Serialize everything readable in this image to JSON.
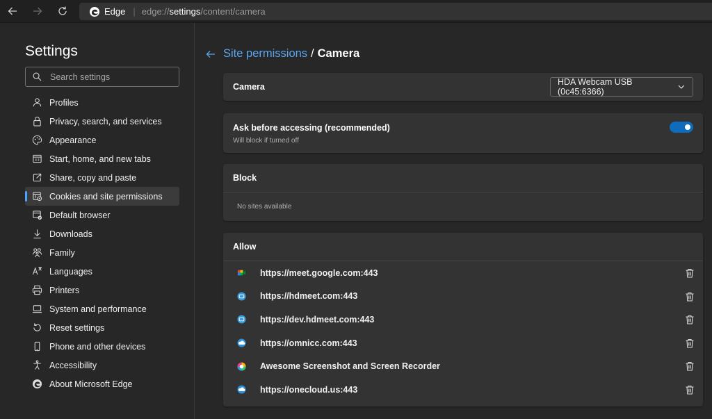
{
  "browser": {
    "site_name": "Edge",
    "url_prefix": "edge://",
    "url_host": "settings",
    "url_path": "/content/camera"
  },
  "sidebar": {
    "title": "Settings",
    "search_placeholder": "Search settings",
    "items": [
      {
        "label": "Profiles",
        "icon": "profile-icon"
      },
      {
        "label": "Privacy, search, and services",
        "icon": "lock-icon"
      },
      {
        "label": "Appearance",
        "icon": "appearance-icon"
      },
      {
        "label": "Start, home, and new tabs",
        "icon": "start-tabs-icon"
      },
      {
        "label": "Share, copy and paste",
        "icon": "share-icon"
      },
      {
        "label": "Cookies and site permissions",
        "icon": "cookies-icon",
        "active": true
      },
      {
        "label": "Default browser",
        "icon": "default-browser-icon"
      },
      {
        "label": "Downloads",
        "icon": "download-icon"
      },
      {
        "label": "Family",
        "icon": "family-icon"
      },
      {
        "label": "Languages",
        "icon": "languages-icon"
      },
      {
        "label": "Printers",
        "icon": "printer-icon"
      },
      {
        "label": "System and performance",
        "icon": "laptop-icon"
      },
      {
        "label": "Reset settings",
        "icon": "reset-icon"
      },
      {
        "label": "Phone and other devices",
        "icon": "phone-icon"
      },
      {
        "label": "Accessibility",
        "icon": "accessibility-icon"
      },
      {
        "label": "About Microsoft Edge",
        "icon": "edge-icon"
      }
    ]
  },
  "main": {
    "breadcrumb_link": "Site permissions",
    "breadcrumb_separator": "/",
    "breadcrumb_current": "Camera",
    "camera_label": "Camera",
    "camera_device": "HDA Webcam USB (0c45:6366)",
    "ask_title": "Ask before accessing (recommended)",
    "ask_subtitle": "Will block if turned off",
    "ask_enabled": true,
    "block_title": "Block",
    "block_empty": "No sites available",
    "allow_title": "Allow",
    "allow_sites": [
      {
        "site": "https://meet.google.com:443",
        "icon": "google-meet-icon"
      },
      {
        "site": "https://hdmeet.com:443",
        "icon": "hdmeet-icon"
      },
      {
        "site": "https://dev.hdmeet.com:443",
        "icon": "hdmeet-icon"
      },
      {
        "site": "https://omnicc.com:443",
        "icon": "cloud-icon"
      },
      {
        "site": "Awesome Screenshot and Screen Recorder",
        "icon": "awesome-screenshot-icon"
      },
      {
        "site": "https://onecloud.us:443",
        "icon": "cloud-icon"
      }
    ]
  },
  "colors": {
    "accent": "#4aa3ff",
    "toggle_on": "#0f6cbd",
    "link": "#5aa7f0"
  }
}
